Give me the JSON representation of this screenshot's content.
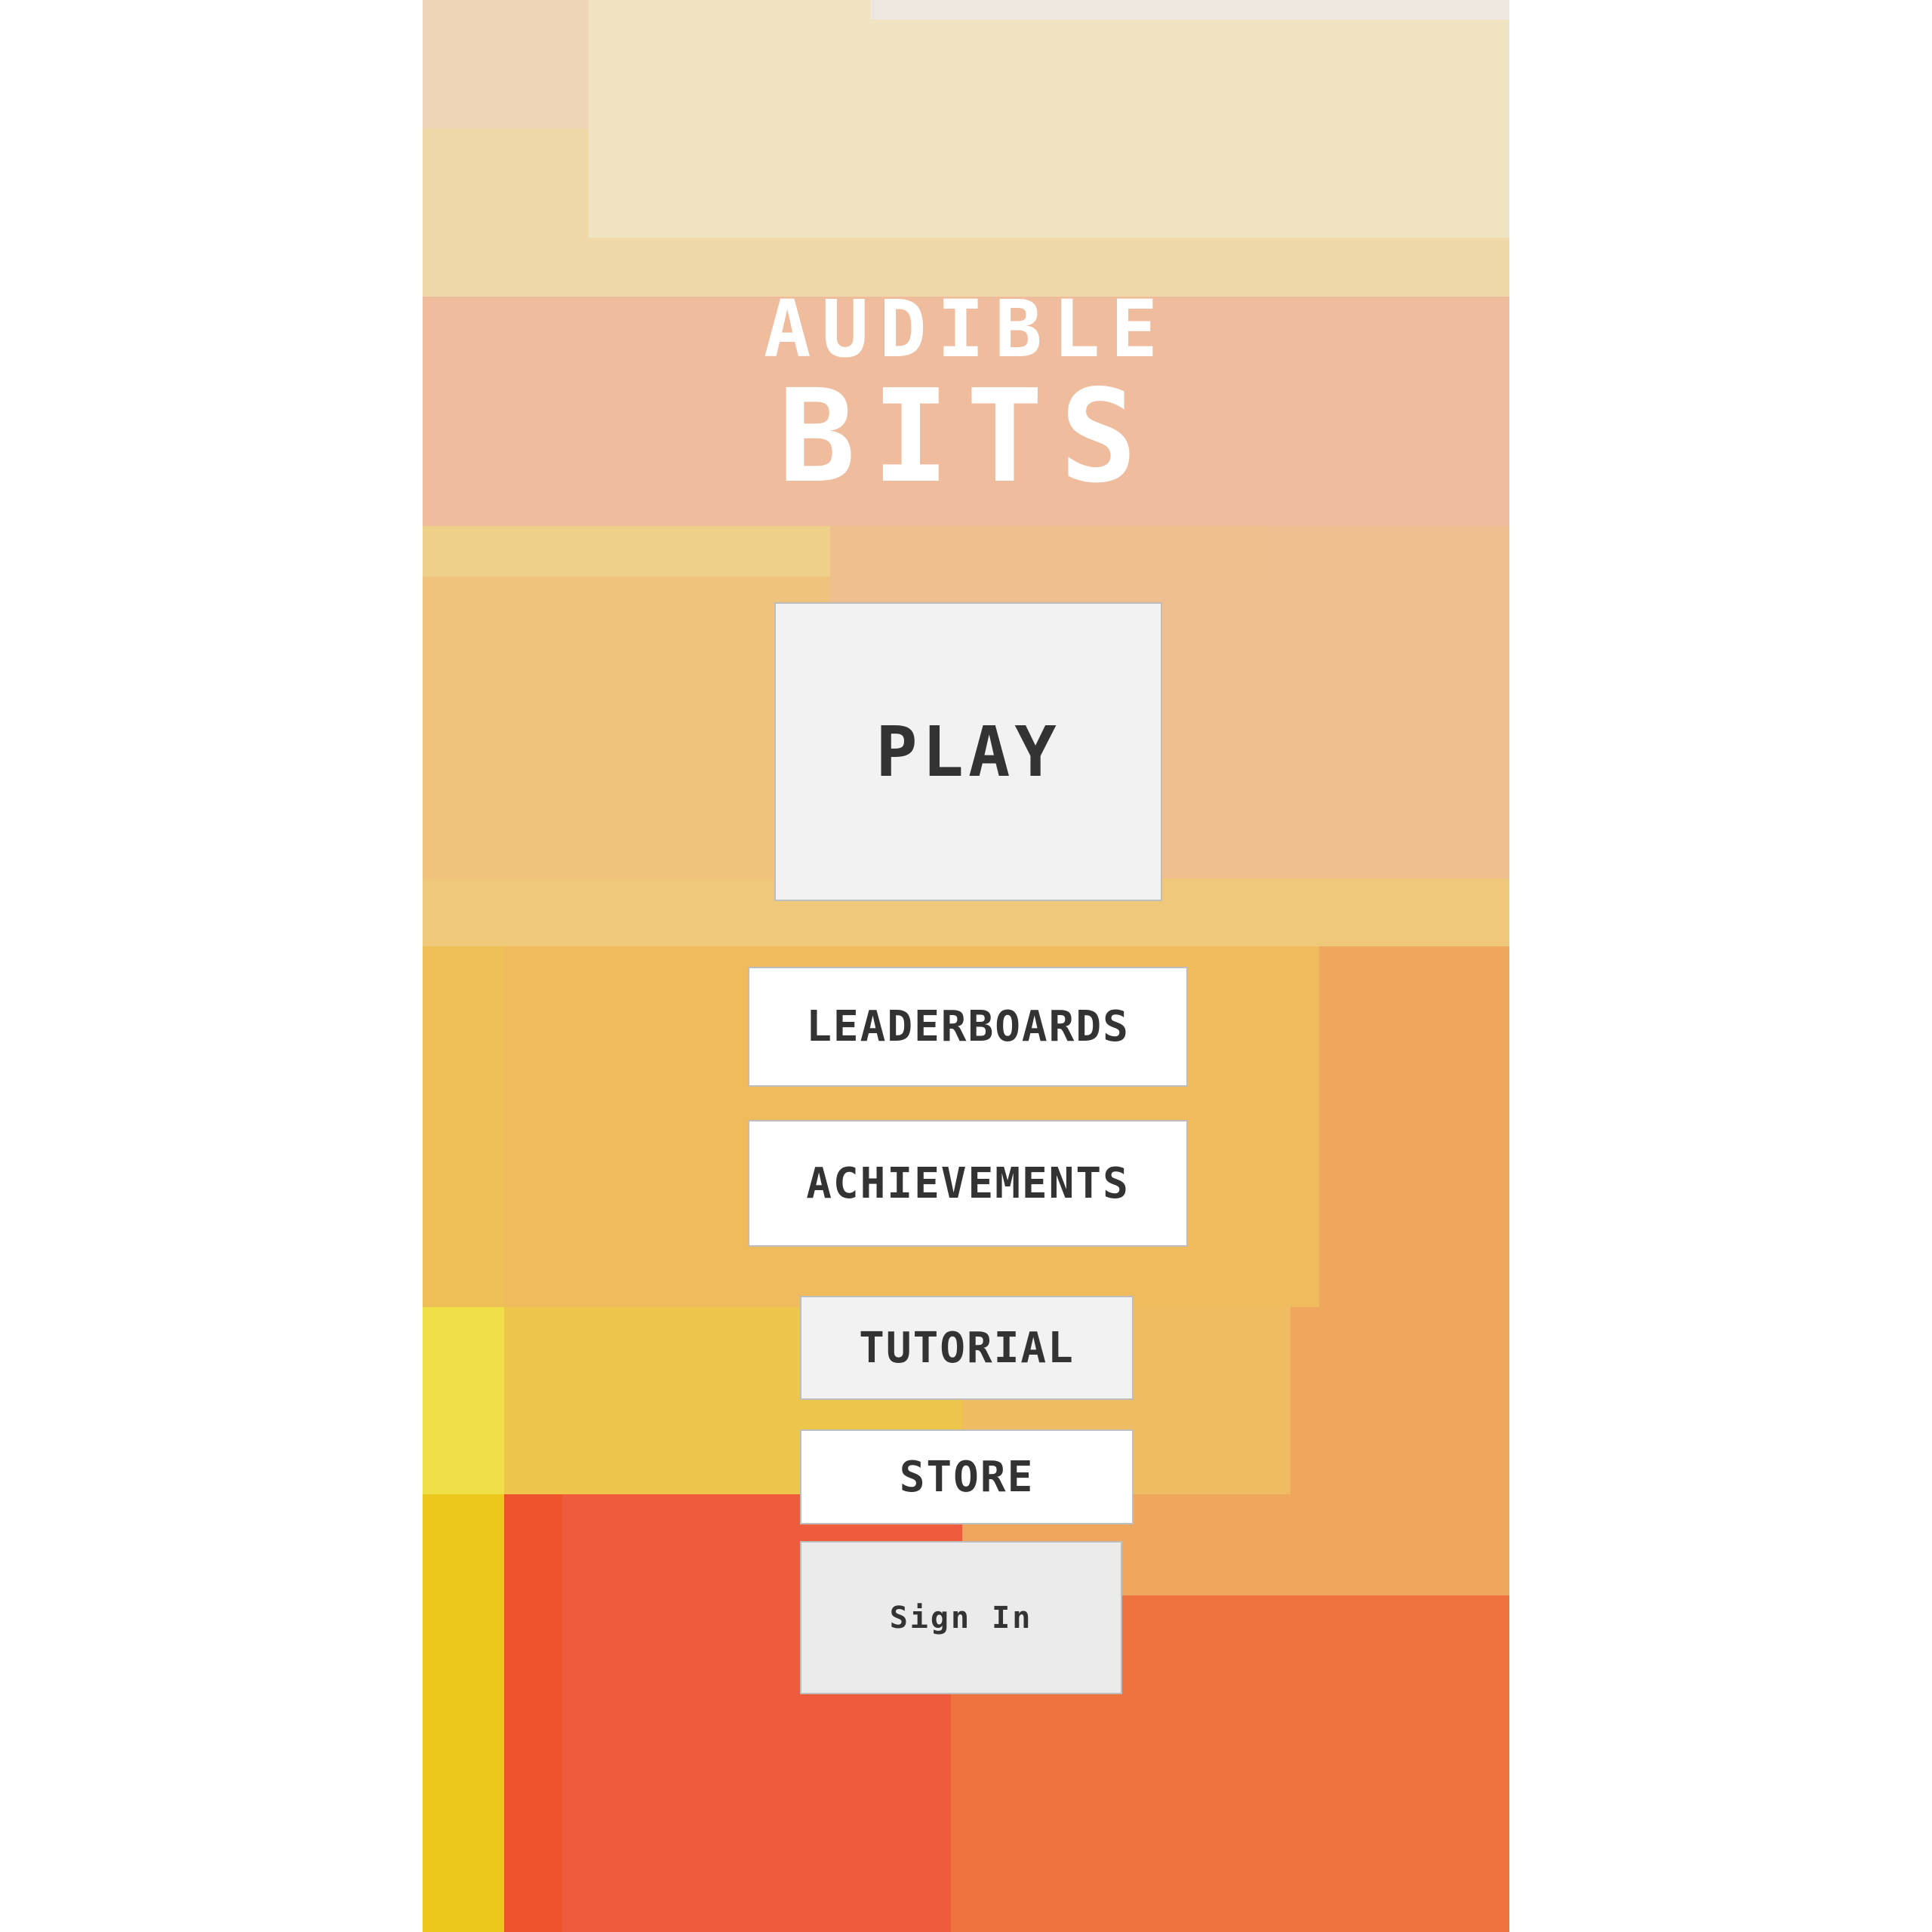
{
  "game": {
    "title_line1": "AUDIBLE",
    "title_line2": "BITS"
  },
  "menu": {
    "play_label": "PLAY",
    "leaderboards_label": "LEADERBOARDS",
    "achievements_label": "ACHIEVEMENTS",
    "tutorial_label": "TUTORIAL",
    "store_label": "STORE",
    "signin_label": "Sign In"
  },
  "colors": {
    "button_text": "#333333",
    "title_text": "#ffffff",
    "page_background": "#ffffff"
  }
}
